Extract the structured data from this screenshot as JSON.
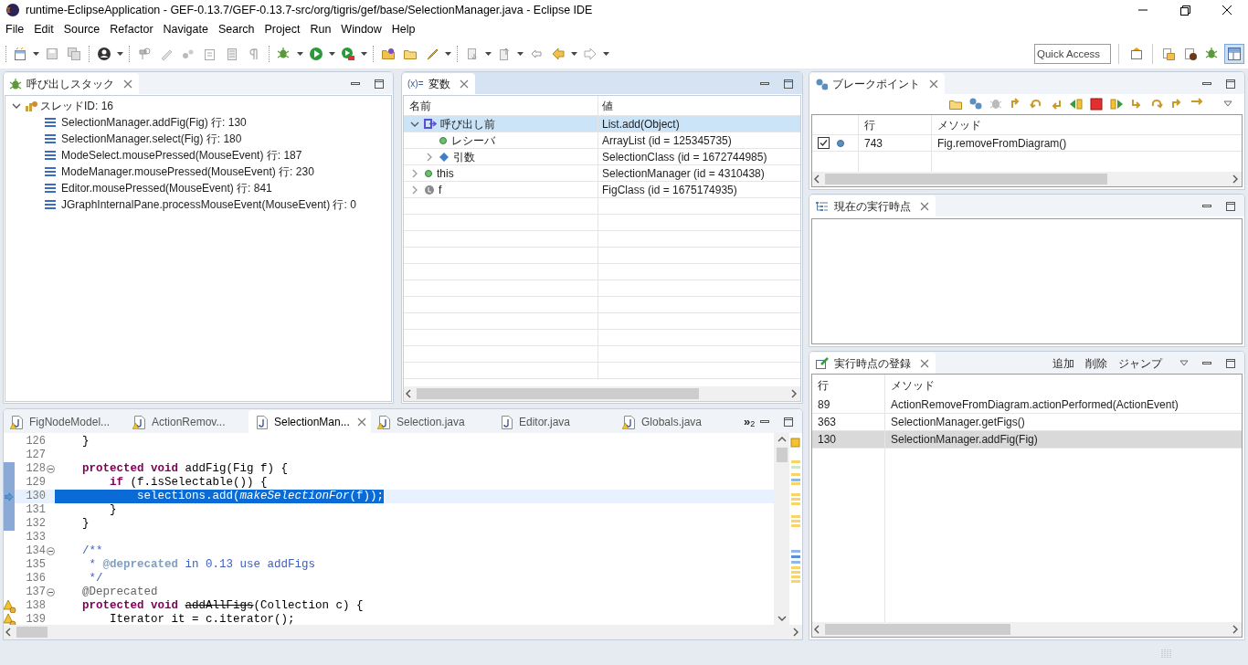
{
  "window": {
    "title": "runtime-EclipseApplication - GEF-0.13.7/GEF-0.13.7-src/org/tigris/gef/base/SelectionManager.java - Eclipse IDE"
  },
  "menu": [
    {
      "label": "File"
    },
    {
      "label": "Edit"
    },
    {
      "label": "Source"
    },
    {
      "label": "Refactor"
    },
    {
      "label": "Navigate"
    },
    {
      "label": "Search"
    },
    {
      "label": "Project"
    },
    {
      "label": "Run"
    },
    {
      "label": "Window"
    },
    {
      "label": "Help"
    }
  ],
  "quick_access": {
    "placeholder": "Quick Access"
  },
  "call_stack": {
    "title": "呼び出しスタック",
    "active": false,
    "thread": {
      "label": "スレッドID: 16",
      "expanded": true,
      "frames": [
        {
          "label": "SelectionManager.addFig(Fig) 行: 130"
        },
        {
          "label": "SelectionManager.select(Fig) 行: 180"
        },
        {
          "label": "ModeSelect.mousePressed(MouseEvent) 行: 187"
        },
        {
          "label": "ModeManager.mousePressed(MouseEvent) 行: 230"
        },
        {
          "label": "Editor.mousePressed(MouseEvent) 行: 841"
        },
        {
          "label": "JGraphInternalPane.processMouseEvent(MouseEvent) 行: 0"
        }
      ]
    }
  },
  "variables": {
    "title": "変数",
    "symbol": "(x)=",
    "active": true,
    "columns": [
      "名前",
      "値"
    ],
    "rows": [
      {
        "name": "呼び出し前",
        "value": "List.add(Object)",
        "kind": "method-result",
        "expanded": true,
        "selected": true,
        "children": [
          {
            "name": "レシーバ",
            "value": "ArrayList (id = 125345735)",
            "kind": "field",
            "selected": false
          },
          {
            "name": "引数",
            "value": "SelectionClass (id = 1672744985)",
            "kind": "argument",
            "expanded": false,
            "selected": false
          }
        ]
      },
      {
        "name": "this",
        "value": "SelectionManager (id = 4310438)",
        "kind": "field",
        "expanded": false,
        "selected": false
      },
      {
        "name": "f",
        "value": "FigClass (id = 1675174935)",
        "kind": "local",
        "expanded": false,
        "selected": false
      }
    ]
  },
  "editor": {
    "tabs": [
      {
        "label": "FigNodeModel...",
        "warning": true,
        "selected": false
      },
      {
        "label": "ActionRemov...",
        "warning": true,
        "selected": false
      },
      {
        "label": "SelectionMan...",
        "warning": false,
        "selected": true
      },
      {
        "label": "Selection.java",
        "warning": true,
        "selected": false
      },
      {
        "label": "Editor.java",
        "warning": false,
        "selected": false
      },
      {
        "label": "Globals.java",
        "warning": true,
        "selected": false
      }
    ],
    "overflow": "»",
    "overflow_count": "2",
    "lines": [
      {
        "number": "126",
        "segments": [
          {
            "text": "    }"
          }
        ]
      },
      {
        "number": "127"
      },
      {
        "number": "128",
        "fold": true,
        "marked": true,
        "segments": [
          {
            "text": "    protected void",
            "kind": "keyword"
          },
          {
            "text": " addFig(Fig f) {"
          }
        ]
      },
      {
        "number": "129",
        "marked": true,
        "segments": [
          {
            "text": "        if",
            "kind": "keyword"
          },
          {
            "text": " (f.isSelectable()) {"
          }
        ]
      },
      {
        "number": "130",
        "marked": true,
        "current": true,
        "selected": true,
        "segments": [
          {
            "text": "            selections.add("
          },
          {
            "text": "makeSelectionFor",
            "kind": "italic"
          },
          {
            "text": "(f));"
          }
        ]
      },
      {
        "number": "131",
        "marked": true,
        "segments": [
          {
            "text": "        }"
          }
        ]
      },
      {
        "number": "132",
        "marked": true,
        "segments": [
          {
            "text": "    }"
          }
        ]
      },
      {
        "number": "133"
      },
      {
        "number": "134",
        "fold": true,
        "segments": [
          {
            "text": "    /**",
            "kind": "comment"
          }
        ]
      },
      {
        "number": "135",
        "segments": [
          {
            "text": "     * ",
            "kind": "comment"
          },
          {
            "text": "@deprecated",
            "kind": "tag"
          },
          {
            "text": " in 0.13 use addFigs",
            "kind": "comment"
          }
        ]
      },
      {
        "number": "136",
        "segments": [
          {
            "text": "     */",
            "kind": "comment"
          }
        ]
      },
      {
        "number": "137",
        "fold": true,
        "segments": [
          {
            "text": "    @Deprecated",
            "kind": "annotation"
          }
        ]
      },
      {
        "number": "138",
        "warning": true,
        "segments": [
          {
            "text": "    protected void ",
            "kind": "keyword"
          },
          {
            "text": "addAllFigs",
            "kind": "deprecated"
          },
          {
            "text": "(Collection c) {"
          }
        ]
      },
      {
        "number": "139",
        "warning": true,
        "segments": [
          {
            "text": "        Iterator it = c.iterator();"
          }
        ]
      }
    ]
  },
  "breakpoints": {
    "title": "ブレークポイント",
    "active": false,
    "columns": [
      "行",
      "メソッド"
    ],
    "rows": [
      {
        "checked": true,
        "line": "743",
        "method": "Fig.removeFromDiagram()"
      }
    ]
  },
  "current_point": {
    "title": "現在の実行時点",
    "active": false
  },
  "registered_points": {
    "title": "実行時点の登録",
    "active": false,
    "actions": [
      "追加",
      "削除",
      "ジャンプ"
    ],
    "columns": [
      "行",
      "メソッド"
    ],
    "rows": [
      {
        "line": "89",
        "method": "ActionRemoveFromDiagram.actionPerformed(ActionEvent)",
        "selected": false
      },
      {
        "line": "363",
        "method": "SelectionManager.getFigs()",
        "selected": false
      },
      {
        "line": "130",
        "method": "SelectionManager.addFig(Fig)",
        "selected": true
      }
    ]
  }
}
